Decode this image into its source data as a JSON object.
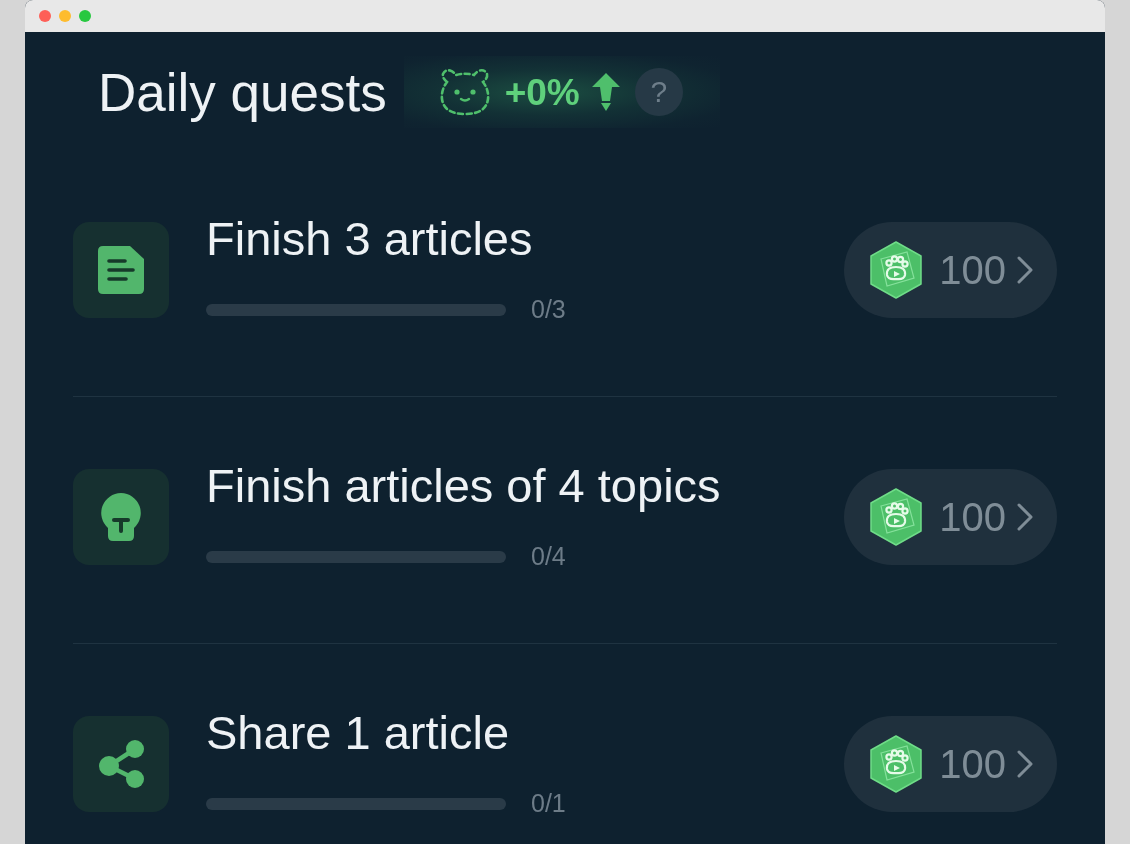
{
  "header": {
    "title": "Daily quests",
    "boost": {
      "value": "+0%",
      "help": "?"
    }
  },
  "quests": [
    {
      "kind": "document",
      "title": "Finish 3 articles",
      "level": 0,
      "progress": "0/3",
      "reward": "100"
    },
    {
      "kind": "bulb",
      "title": "Finish articles of 4 topics",
      "level": 0,
      "progress": "0/4",
      "reward": "100"
    },
    {
      "kind": "share",
      "title": "Share 1 article",
      "level": 0,
      "progress": "0/1",
      "reward": "100"
    }
  ]
}
